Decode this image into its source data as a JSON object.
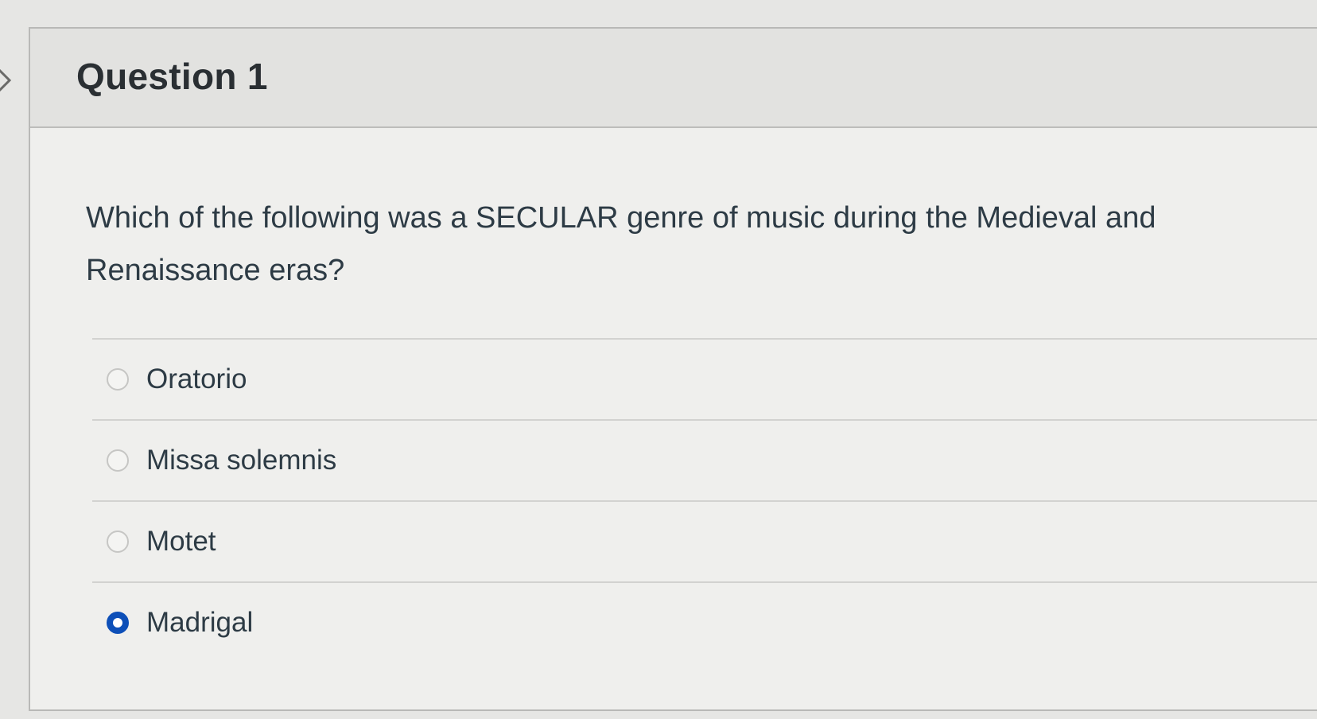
{
  "question": {
    "title": "Question 1",
    "text": "Which of the following was a SECULAR genre of music during the Medieval and Renaissance eras?",
    "answers": [
      {
        "label": "Oratorio",
        "selected": false
      },
      {
        "label": "Missa solemnis",
        "selected": false
      },
      {
        "label": "Motet",
        "selected": false
      },
      {
        "label": "Madrigal",
        "selected": true
      }
    ]
  },
  "colors": {
    "accent": "#0d4fb8",
    "text": "#2d3b45",
    "header_bg": "#e2e2e0",
    "card_bg": "#efefed"
  },
  "icons": {
    "nav": "chevron-right-icon"
  }
}
